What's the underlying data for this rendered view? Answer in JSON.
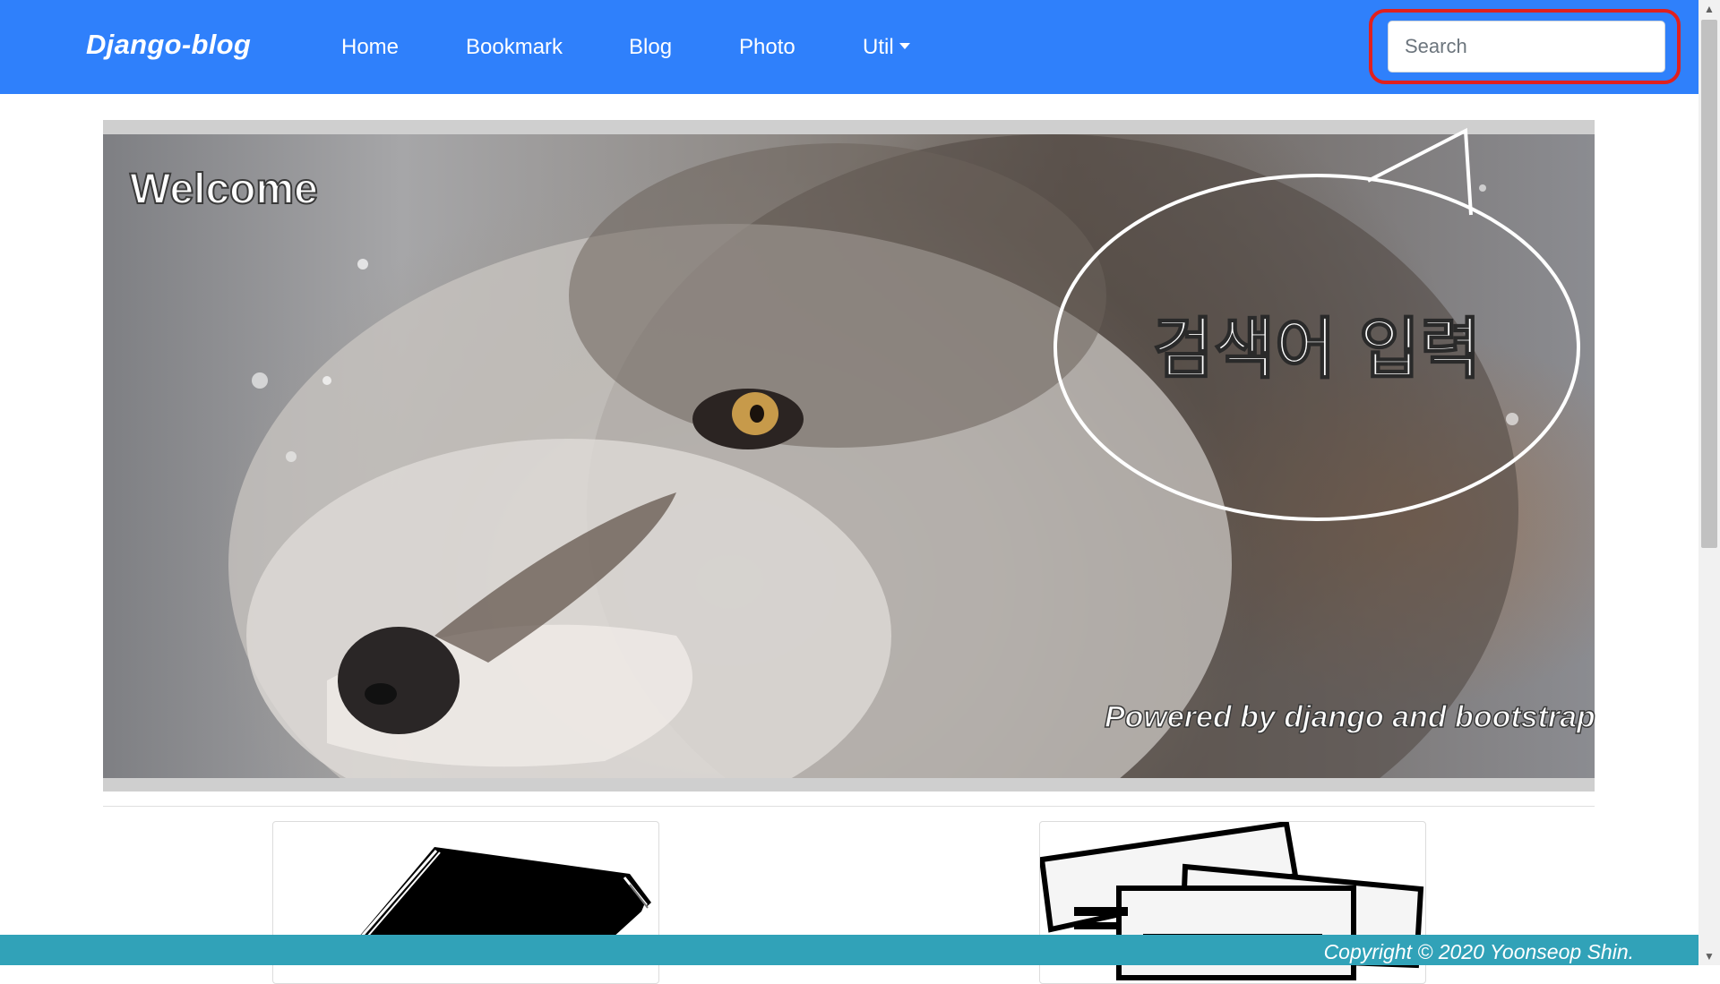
{
  "navbar": {
    "brand": "Django-blog",
    "items": [
      {
        "label": "Home"
      },
      {
        "label": "Bookmark"
      },
      {
        "label": "Blog"
      },
      {
        "label": "Photo"
      },
      {
        "label": "Util"
      }
    ],
    "search": {
      "placeholder": "Search",
      "value": ""
    }
  },
  "hero": {
    "welcome": "Welcome",
    "bubble_text": "검색어 입력",
    "powered": "Powered by django and bootstrap"
  },
  "cards": [
    {
      "icon": "book-icon"
    },
    {
      "icon": "photos-icon"
    }
  ],
  "footer": {
    "copyright": "Copyright © 2020 Yoonseop Shin."
  },
  "colors": {
    "navbar_bg": "#2f80fb",
    "footer_bg": "#31a2b8",
    "highlight_ring": "#e0201e"
  }
}
